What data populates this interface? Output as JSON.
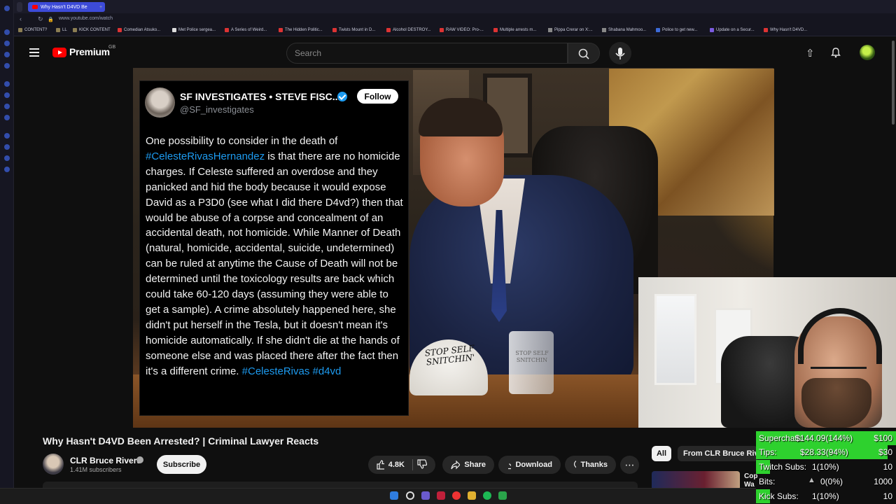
{
  "browser": {
    "active_tab_title": "Why Hasn't D4VD Be",
    "url": "www.youtube.com/watch",
    "bookmarks": [
      "CONTENT?",
      "LL",
      "KICK CONTENT",
      "Comedian Atsuko...",
      "Met Police sergea...",
      "A Series of Weird...",
      "The Hidden Politic...",
      "Twists Mount in D...",
      "Alcohol DESTROY...",
      "RAW VIDEO: Pro-...",
      "Multiple arrests m...",
      "Pippa Crerar on X:...",
      "Shabana Mahmoo...",
      "Police to get new...",
      "Update on a Secur...",
      "Why Hasn't D4VD..."
    ]
  },
  "youtube": {
    "logo_text": "Premium",
    "region": "GB",
    "search_placeholder": "Search"
  },
  "tweet": {
    "name": "SF INVESTIGATES • STEVE FISC...",
    "handle": "@SF_investigates",
    "follow_label": "Follow",
    "line_1": "One possibility to consider in the death of",
    "hashtag_1": "#CelesteRivasHernandez",
    "line_2": " is that there are no homicide charges. If Celeste suffered an overdose and they panicked and hid the body because it would expose David as a P3D0 (see what I did there D4vd?) then that would be abuse of a corpse and concealment of an accidental death, not homicide. While Manner of Death (natural, homicide, accidental, suicide, undetermined) can be ruled at anytime the Cause of Death will not be determined until the toxicology results are back which could take 60-120 days (assuming they were able to get a sample). A crime absolutely happened here, she didn't put herself in the Tesla, but it doesn't mean it's homicide automatically. If she didn't die at the hands of someone else and was placed there after the fact then it's a different crime. ",
    "hashtag_2": "#CelesteRivas",
    "hashtag_3": "#d4vd"
  },
  "video_scene": {
    "hat_text": "STOP SELF SNITCHIN'",
    "mug_text": "STOP SELF SNITCHIN"
  },
  "video": {
    "title": "Why Hasn't D4VD Been Arrested? | Criminal Lawyer Reacts",
    "channel_name": "CLR Bruce Rivers",
    "subscribers": "1.41M subscribers",
    "subscribe_label": "Subscribe",
    "likes": "4.8K",
    "share_label": "Share",
    "download_label": "Download",
    "thanks_label": "Thanks",
    "more_label": "⋯"
  },
  "recommendations": {
    "chip_all": "All",
    "chip_channel": "From CLR Bruce Rivers",
    "rec_title": "Cop\nWa"
  },
  "overlay": {
    "superchats": {
      "label": "Superchats:",
      "value": "$144.09(144%)",
      "goal": "$100",
      "fraction": 1.0
    },
    "tips": {
      "label": "Tips:",
      "value": "$28.33(94%)",
      "goal": "$30",
      "fraction": 0.94
    },
    "twitch_subs": {
      "label": "Twitch Subs:",
      "value": "1(10%)",
      "goal": "10",
      "fraction": 0.1
    },
    "bits": {
      "label": "Bits:",
      "value": "0(0%)",
      "goal": "1000",
      "fraction": 0.0
    },
    "kick_subs": {
      "label": "Kick Subs:",
      "value": "1(10%)",
      "goal": "10",
      "fraction": 0.1
    }
  },
  "colors": {
    "yt_red": "#ff0000",
    "link_blue": "#1d9bf0",
    "overlay_green": "#2ed12e",
    "browser_active_tab": "#3d4bd8"
  }
}
